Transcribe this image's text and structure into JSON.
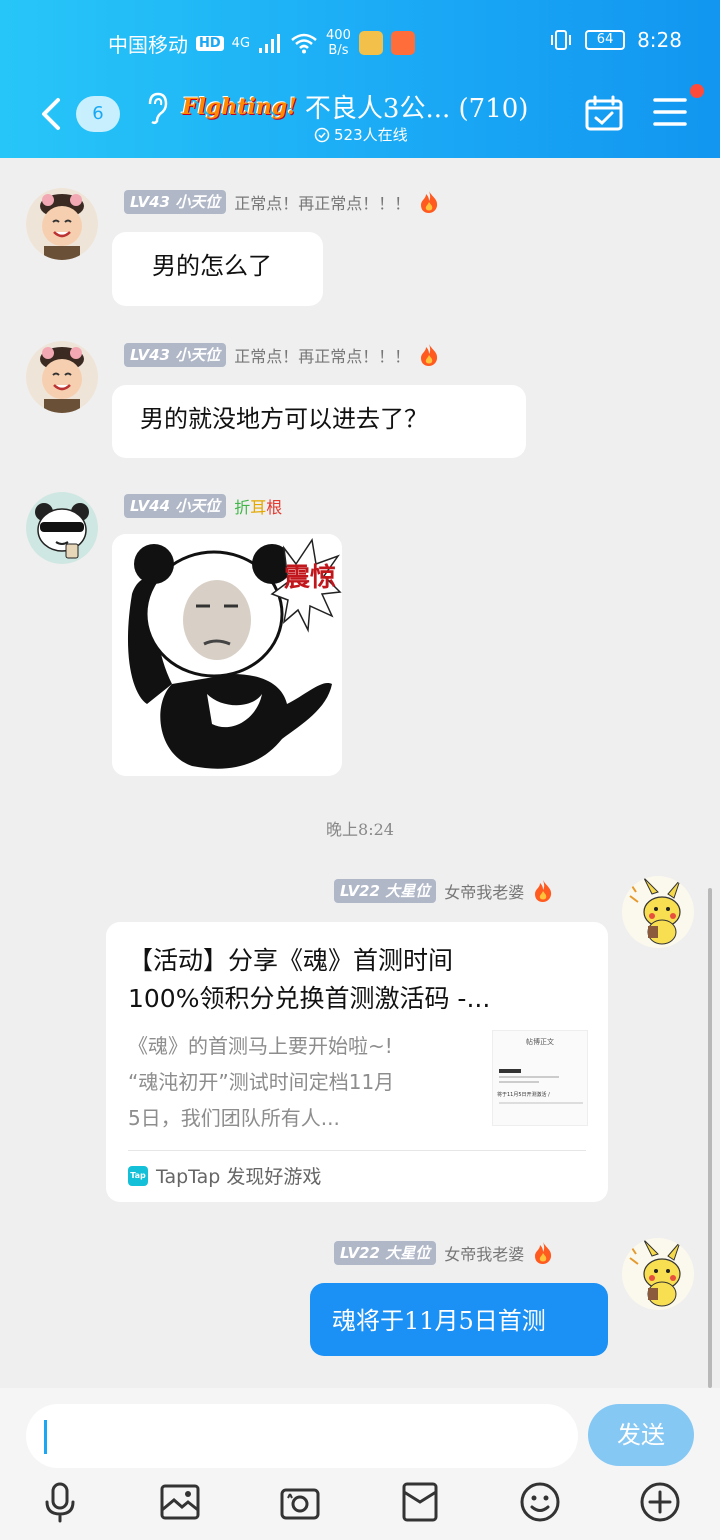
{
  "status_bar": {
    "carrier": "中国移动",
    "hd": "HD",
    "network": "4G",
    "speed_value": "400",
    "speed_unit": "B/s",
    "battery": "64",
    "time": "8:28"
  },
  "header": {
    "unread_count": "6",
    "brand": "Flghting!",
    "group_name": "不良人3公... (710)",
    "online": "523人在线"
  },
  "messages": [
    {
      "level": "LV43",
      "rank": "小天位",
      "title": "正常点！再正常点！！！",
      "text": "男的怎么了"
    },
    {
      "level": "LV43",
      "rank": "小天位",
      "title": "正常点！再正常点！！！",
      "text": "男的就没地方可以进去了？"
    },
    {
      "level": "LV44",
      "rank": "小天位",
      "title_chars": [
        "折",
        "耳",
        "根"
      ],
      "sticker_text": "震惊"
    }
  ],
  "timestamp": "晚上8:24",
  "card_message": {
    "level": "LV22",
    "rank": "大星位",
    "title": "女帝我老婆",
    "card_title_line1": "【活动】分享《魂》首测时间",
    "card_title_line2": "100%领积分兑换首测激活码 -...",
    "card_desc_line1": "《魂》的首测马上要开始啦~!",
    "card_desc_line2": "“魂沌初开”测试时间定档11月",
    "card_desc_line3": "5日，我们团队所有人...",
    "thumb_title": "帖博正文",
    "thumb_line": "将于11月5日开测激活 /",
    "source_icon": "Tap",
    "source": "TapTap 发现好游戏"
  },
  "last_message": {
    "level": "LV22",
    "rank": "大星位",
    "title": "女帝我老婆",
    "text": "魂将于11月5日首测"
  },
  "input": {
    "send_label": "发送"
  },
  "colors": {
    "header": "#1aa8f5",
    "bubble_blue": "#1b90f5",
    "send_button": "#86c8f4",
    "level_badge": "#b0b7c7"
  }
}
